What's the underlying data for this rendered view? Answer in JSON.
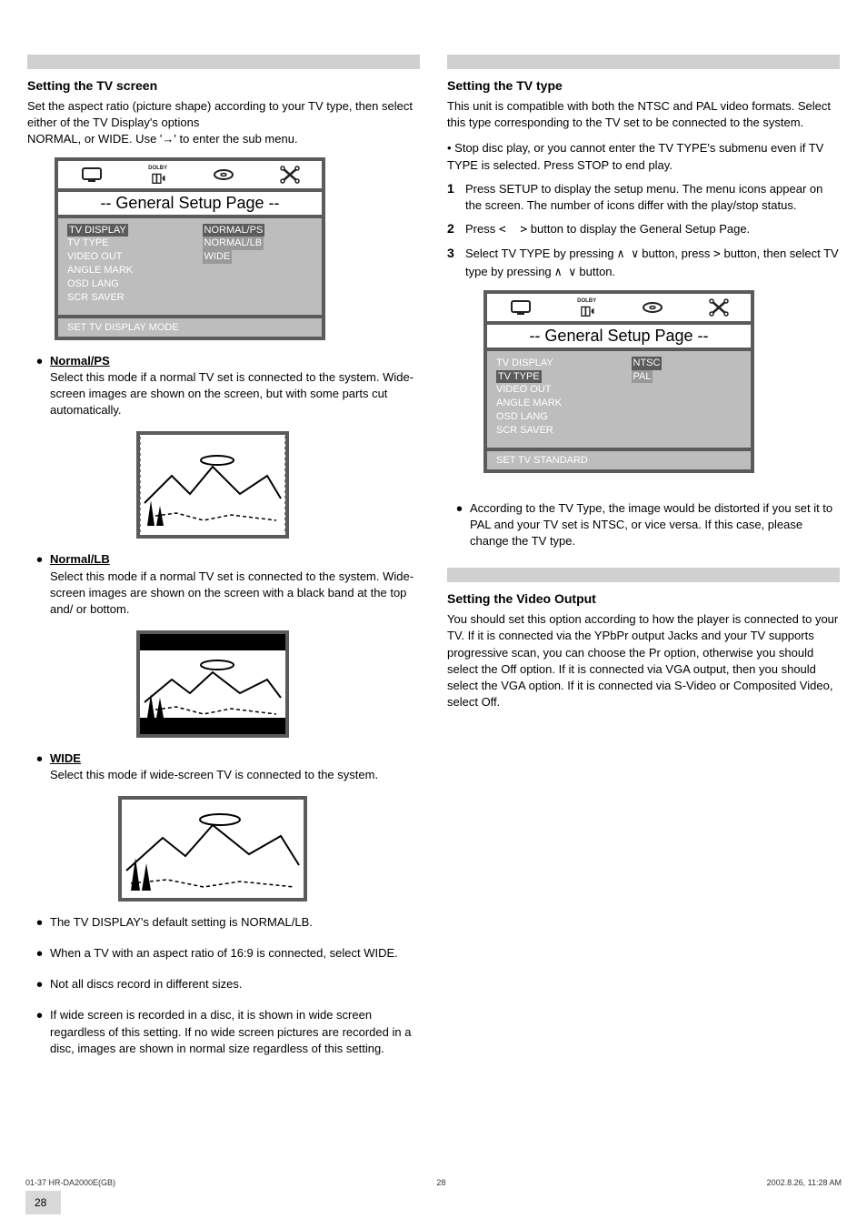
{
  "left": {
    "section_title": "Setting the TV screen",
    "intro1": "Set the aspect ratio (picture shape) according to your TV type, then select either of the TV Display's options",
    "intro2_prefix": "NORMAL, or WIDE. Use '",
    "arrow": "→",
    "intro2_suffix": "' to enter the sub menu.",
    "setup_header": "-- General  Setup  Page --",
    "setup_left": [
      "TV DISPLAY",
      "TV TYPE",
      "VIDEO OUT",
      "ANGLE MARK",
      "OSD LANG",
      "SCR SAVER"
    ],
    "setup_right": [
      "NORMAL/PS",
      "NORMAL/LB",
      "WIDE"
    ],
    "setup_foot": "SET TV DISPLAY MODE",
    "b1_label": "Normal/PS",
    "b1_text": "Select this mode if a normal TV set is connected to the system. Wide-screen images are shown on the screen, but with some parts cut automatically.",
    "b2_label": "Normal/LB",
    "b2_text": "Select this mode if a normal TV set is connected to the system. Wide-screen images are shown on the screen with a black band at the top and/ or bottom.",
    "b3_label": "WIDE",
    "b3_text": "Select this mode if wide-screen TV is connected to the system.",
    "b4": "The TV DISPLAY's default setting is NORMAL/LB.",
    "b5": "When a TV with an aspect ratio of 16:9 is connected, select WIDE.",
    "b6": "Not all discs record in different sizes.",
    "b7": "If wide screen is recorded in a disc, it is shown in wide screen regardless of this setting. If no wide screen pictures are recorded in a disc, images are shown in normal size regardless of this setting."
  },
  "right": {
    "section1_title": "Setting the TV type",
    "p1": "This unit is compatible with both the NTSC and PAL video formats. Select this type corresponding to the TV set to be connected to the system.",
    "p2": "• Stop disc play, or you cannot enter the TV TYPE's submenu even if TV TYPE is selected. Press STOP to end play.",
    "step1_num": "1",
    "step1_body": "Press SETUP to display the setup menu. The menu icons appear on the screen. The number of icons differ with the play/stop status.",
    "step2_num": "2",
    "step2_body_a": "Press ",
    "step2_body_b": " button to display the General Setup Page.",
    "step3_num": "3",
    "step3_body_a": "Select TV TYPE by pressing ",
    "step3_body_b": " button, press ",
    "step3_body_c": " button, then select TV type by pressing ",
    "step3_body_d": " button.",
    "setup_header": "-- General  Setup  Page --",
    "setup_left": [
      "TV DISPLAY",
      "TV TYPE",
      "VIDEO OUT",
      "ANGLE MARK",
      "OSD LANG",
      "SCR SAVER"
    ],
    "setup_right": [
      "NTSC",
      "PAL"
    ],
    "setup_foot": "SET TV STANDARD",
    "bullet_1": "According to the TV Type, the image would be distorted if you set it to PAL and your TV set is NTSC, or vice versa. If this case, please change the TV type.",
    "section2_title": "Setting the Video Output",
    "p3": "You should set this option according to how the player is connected to your TV. If it is connected via the YPbPr output Jacks and your TV supports progressive scan, you can choose the Pr option, otherwise you should select the Off option. If it is connected via VGA output, then you should select the VGA option. If it is connected via S-Video or Composited Video, select Off."
  },
  "footer": {
    "left": "2002.8.26, 11:28 AM",
    "right": "28",
    "page": "28",
    "filename": "01-37 HR-DA2000E(GB)"
  }
}
